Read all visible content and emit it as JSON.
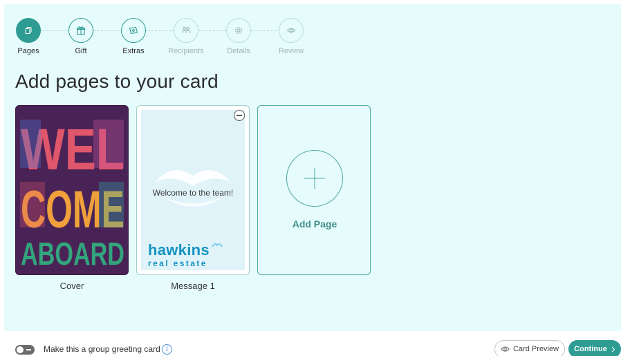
{
  "stepper": {
    "steps": [
      {
        "label": "Pages",
        "icon": "pages-icon",
        "state": "active"
      },
      {
        "label": "Gift",
        "icon": "gift-icon",
        "state": "done"
      },
      {
        "label": "Extras",
        "icon": "ticket-icon",
        "state": "done"
      },
      {
        "label": "Recipients",
        "icon": "people-icon",
        "state": "future"
      },
      {
        "label": "Details",
        "icon": "gear-icon",
        "state": "future"
      },
      {
        "label": "Review",
        "icon": "eye-icon",
        "state": "future"
      }
    ]
  },
  "main": {
    "title": "Add pages to your card",
    "cards": [
      {
        "caption": "Cover",
        "art_lines": [
          "WEL",
          "COME",
          "ABOARD"
        ]
      },
      {
        "caption": "Message 1",
        "message": "Welcome to the team!",
        "logo_name": "hawkins",
        "logo_tagline": "real estate"
      }
    ],
    "add_page_label": "Add Page"
  },
  "footer": {
    "group_label": "Make this a group greeting card",
    "group_enabled": false,
    "preview_label": "Card Preview",
    "continue_label": "Continue"
  },
  "colors": {
    "accent": "#2e9c93",
    "panel_bg": "#e6fbfc",
    "logo_blue": "#1594c2",
    "cover_bg": "#4a2356"
  }
}
